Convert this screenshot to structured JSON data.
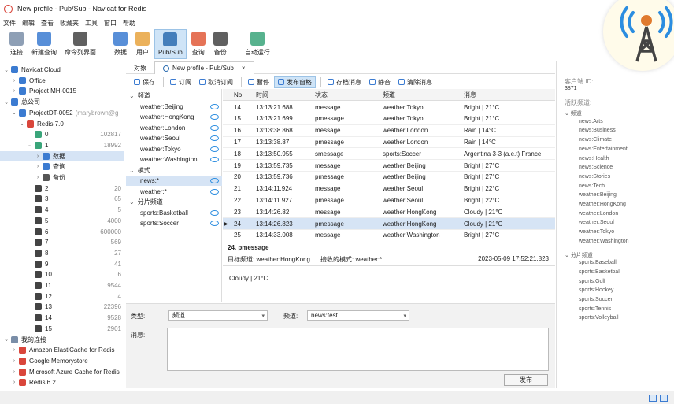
{
  "window": {
    "title": "New profile - Pub/Sub - Navicat for Redis"
  },
  "menu": [
    "文件",
    "编辑",
    "查看",
    "收藏夹",
    "工具",
    "窗口",
    "帮助"
  ],
  "toolbar": [
    {
      "label": "连接",
      "icon": "connect-icon",
      "color": "#7a8ea8"
    },
    {
      "label": "新建查询",
      "icon": "new-query-icon",
      "color": "#3b7bd1"
    },
    {
      "label": "命令列界面",
      "icon": "console-icon",
      "color": "#444444"
    },
    {
      "label": "数据",
      "icon": "data-icon",
      "color": "#3b7bd1"
    },
    {
      "label": "用户",
      "icon": "user-icon",
      "color": "#e7a33e"
    },
    {
      "label": "Pub/Sub",
      "icon": "pubsub-icon",
      "color": "#2b6cb0",
      "active": true
    },
    {
      "label": "查询",
      "icon": "query-icon",
      "color": "#e05a3a"
    },
    {
      "label": "备份",
      "icon": "backup-icon",
      "color": "#444444"
    },
    {
      "label": "自动运行",
      "icon": "automation-icon",
      "color": "#3aa57a"
    }
  ],
  "tree": [
    {
      "label": "Navicat Cloud",
      "depth": 0,
      "arrow": "v",
      "icon": "cloud-icon",
      "color": "#3b7bd1"
    },
    {
      "label": "Office",
      "depth": 1,
      "arrow": ">",
      "icon": "office-icon",
      "color": "#3b7bd1"
    },
    {
      "label": "Project MH-0015",
      "depth": 1,
      "arrow": ">",
      "icon": "project-icon",
      "color": "#3b7bd1"
    },
    {
      "label": "总公司",
      "depth": 0,
      "arrow": "v",
      "icon": "cloud-icon",
      "color": "#3b7bd1"
    },
    {
      "label": "ProjectDT-0052",
      "suffix": "(marybrown@g",
      "depth": 1,
      "arrow": "v",
      "icon": "project-icon",
      "color": "#3b7bd1"
    },
    {
      "label": "Redis 7.0",
      "depth": 2,
      "arrow": "v",
      "icon": "redis-icon",
      "color": "#d9463b"
    },
    {
      "label": "0",
      "count": "102817",
      "depth": 3,
      "arrow": "",
      "icon": "db-icon",
      "color": "#3aa57a"
    },
    {
      "label": "1",
      "count": "18992",
      "depth": 3,
      "arrow": "v",
      "icon": "db-icon",
      "color": "#3aa57a"
    },
    {
      "label": "数据",
      "depth": 4,
      "arrow": ">",
      "icon": "data-icon",
      "color": "#3b7bd1",
      "selected": true
    },
    {
      "label": "查询",
      "depth": 4,
      "arrow": ">",
      "icon": "query-icon",
      "color": "#3b7bd1"
    },
    {
      "label": "备份",
      "depth": 4,
      "arrow": ">",
      "icon": "backup-icon",
      "color": "#555555"
    },
    {
      "label": "2",
      "count": "20",
      "depth": 3,
      "arrow": "",
      "icon": "db-icon",
      "color": "#444444"
    },
    {
      "label": "3",
      "count": "65",
      "depth": 3,
      "arrow": "",
      "icon": "db-icon",
      "color": "#444444"
    },
    {
      "label": "4",
      "count": "5",
      "depth": 3,
      "arrow": "",
      "icon": "db-icon",
      "color": "#444444"
    },
    {
      "label": "5",
      "count": "4000",
      "depth": 3,
      "arrow": "",
      "icon": "db-icon",
      "color": "#444444"
    },
    {
      "label": "6",
      "count": "600000",
      "depth": 3,
      "arrow": "",
      "icon": "db-icon",
      "color": "#444444"
    },
    {
      "label": "7",
      "count": "569",
      "depth": 3,
      "arrow": "",
      "icon": "db-icon",
      "color": "#444444"
    },
    {
      "label": "8",
      "count": "27",
      "depth": 3,
      "arrow": "",
      "icon": "db-icon",
      "color": "#444444"
    },
    {
      "label": "9",
      "count": "41",
      "depth": 3,
      "arrow": "",
      "icon": "db-icon",
      "color": "#444444"
    },
    {
      "label": "10",
      "count": "6",
      "depth": 3,
      "arrow": "",
      "icon": "db-icon",
      "color": "#444444"
    },
    {
      "label": "11",
      "count": "9544",
      "depth": 3,
      "arrow": "",
      "icon": "db-icon",
      "color": "#444444"
    },
    {
      "label": "12",
      "count": "4",
      "depth": 3,
      "arrow": "",
      "icon": "db-icon",
      "color": "#444444"
    },
    {
      "label": "13",
      "count": "22396",
      "depth": 3,
      "arrow": "",
      "icon": "db-icon",
      "color": "#444444"
    },
    {
      "label": "14",
      "count": "9528",
      "depth": 3,
      "arrow": "",
      "icon": "db-icon",
      "color": "#444444"
    },
    {
      "label": "15",
      "count": "2901",
      "depth": 3,
      "arrow": "",
      "icon": "db-icon",
      "color": "#444444"
    },
    {
      "label": "我的连接",
      "depth": 0,
      "arrow": "v",
      "icon": "connect-icon",
      "color": "#7a8ea8"
    },
    {
      "label": "Amazon ElastiCache for Redis",
      "depth": 1,
      "arrow": ">",
      "icon": "aws-icon",
      "color": "#d9463b"
    },
    {
      "label": "Google Memorystore",
      "depth": 1,
      "arrow": ">",
      "icon": "google-icon",
      "color": "#d9463b"
    },
    {
      "label": "Microsoft Azure Cache for Redis",
      "depth": 1,
      "arrow": ">",
      "icon": "azure-icon",
      "color": "#d9463b"
    },
    {
      "label": "Redis 6.2",
      "depth": 1,
      "arrow": ">",
      "icon": "redis-icon",
      "color": "#d9463b"
    }
  ],
  "tabs": [
    {
      "label": "对象",
      "active": false
    },
    {
      "label": "New profile - Pub/Sub",
      "active": true,
      "close": "×"
    }
  ],
  "subtoolbar": [
    {
      "label": "保存",
      "icon": "save-icon"
    },
    {
      "label": "订阅",
      "icon": "subscribe-icon"
    },
    {
      "label": "取消订阅",
      "icon": "unsubscribe-icon"
    },
    {
      "label": "暂停",
      "icon": "pause-icon"
    },
    {
      "label": "发布窗格",
      "icon": "publish-pane-icon",
      "active": true
    },
    {
      "label": "存档消息",
      "icon": "archive-icon"
    },
    {
      "label": "静音",
      "icon": "mute-icon"
    },
    {
      "label": "清除消息",
      "icon": "clear-icon"
    }
  ],
  "channels": {
    "group1": "频道",
    "list1": [
      "weather:Beijing",
      "weather:HongKong",
      "weather:London",
      "weather:Seoul",
      "weather:Tokyo",
      "weather:Washington"
    ],
    "group2": "模式",
    "list2": [
      "news:*",
      "weather:*"
    ],
    "group3": "分片频道",
    "list3": [
      "sports:Basketball",
      "sports:Soccer"
    ]
  },
  "table": {
    "headers": [
      "No.",
      "时间",
      "状态",
      "频道",
      "消息"
    ],
    "rows": [
      [
        "14",
        "13:13:21.688",
        "message",
        "weather:Tokyo",
        "Bright | 21°C"
      ],
      [
        "15",
        "13:13:21.699",
        "pmessage",
        "weather:Tokyo",
        "Bright | 21°C"
      ],
      [
        "16",
        "13:13:38.868",
        "message",
        "weather:London",
        "Rain | 14°C"
      ],
      [
        "17",
        "13:13:38.87",
        "pmessage",
        "weather:London",
        "Rain | 14°C"
      ],
      [
        "18",
        "13:13:50.955",
        "smessage",
        "sports:Soccer",
        "Argentina 3-3 (a.e.t) France"
      ],
      [
        "19",
        "13:13:59.735",
        "message",
        "weather:Beijing",
        "Bright | 27°C"
      ],
      [
        "20",
        "13:13:59.736",
        "pmessage",
        "weather:Beijing",
        "Bright | 27°C"
      ],
      [
        "21",
        "13:14:11.924",
        "message",
        "weather:Seoul",
        "Bright | 22°C"
      ],
      [
        "22",
        "13:14:11.927",
        "pmessage",
        "weather:Seoul",
        "Bright | 22°C"
      ],
      [
        "23",
        "13:14:26.82",
        "message",
        "weather:HongKong",
        "Cloudy | 21°C"
      ],
      [
        "24",
        "13:14:26.823",
        "pmessage",
        "weather:HongKong",
        "Cloudy | 21°C"
      ],
      [
        "25",
        "13:14:33.008",
        "message",
        "weather:Washington",
        "Bright | 27°C"
      ]
    ],
    "selected_no": "24"
  },
  "detail": {
    "title": "24. pmessage",
    "target": "目标频道: weather:HongKong",
    "pattern": "接收的模式: weather:*",
    "timestamp": "2023-05-09 17:52:21.823",
    "body": "Cloudy | 21°C"
  },
  "publish": {
    "type_label": "类型:",
    "type_value": "频道",
    "channel_label": "频道:",
    "channel_value": "news:test",
    "message_label": "消息:",
    "button": "发布"
  },
  "right": {
    "client_id_label": "客户端 ID:",
    "client_id": "3871",
    "active_label": "活跃频道:",
    "group1": "频道",
    "list1": [
      "news:Arts",
      "news:Business",
      "news:Climate",
      "news:Entertainment",
      "news:Health",
      "news:Science",
      "news:Stories",
      "news:Tech",
      "weather:Beijing",
      "weather:HongKong",
      "weather:London",
      "weather:Seoul",
      "weather:Tokyo",
      "weather:Washington"
    ],
    "group2": "分片频道",
    "list2": [
      "sports:Baseball",
      "sports:Basketball",
      "sports:Golf",
      "sports:Hockey",
      "sports:Soccer",
      "sports:Tennis",
      "sports:Volleyball"
    ]
  },
  "colors": {
    "accent": "#2b8de0",
    "selection": "#d6e4f5",
    "badge": "#e07a2e"
  }
}
